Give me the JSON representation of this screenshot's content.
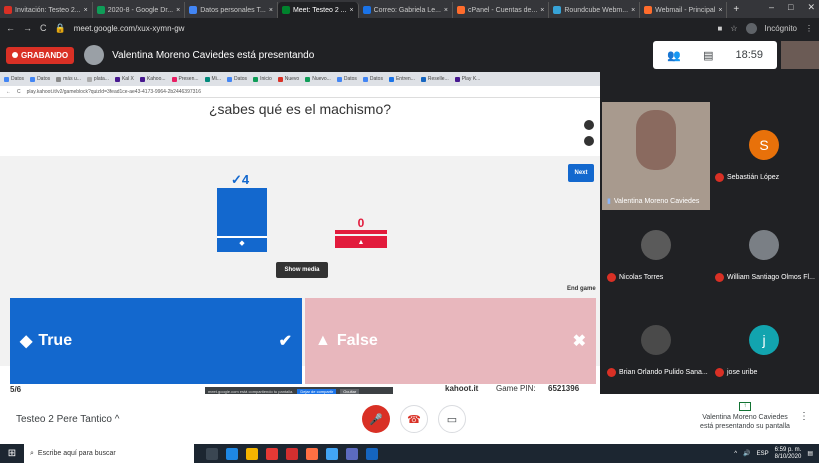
{
  "browser": {
    "tabs": [
      {
        "label": "Invitación: Testeo 2...",
        "color": "#d93025",
        "active": false
      },
      {
        "label": "2020-8 - Google Dr...",
        "color": "#0f9d58",
        "active": false
      },
      {
        "label": "Datos personales T...",
        "color": "#4285f4",
        "active": false
      },
      {
        "label": "Meet: Testeo 2 ...",
        "color": "#00832d",
        "active": true
      },
      {
        "label": "Correo: Gabriela Le...",
        "color": "#1a73e8",
        "active": false
      },
      {
        "label": "cPanel - Cuentas de...",
        "color": "#ff6c2c",
        "active": false
      },
      {
        "label": "Roundcube Webm...",
        "color": "#37a3d7",
        "active": false
      },
      {
        "label": "Webmail - Principal",
        "color": "#ff6c2c",
        "active": false
      }
    ],
    "new_tab": "+",
    "window_controls": [
      "–",
      "□",
      "✕"
    ],
    "url": "meet.google.com/xux-xymn-gw",
    "incognito_label": "Incógnito"
  },
  "meet": {
    "recording_label": "GRABANDO",
    "presenting_text": "Valentina Moreno Caviedes está presentando",
    "time": "18:59",
    "meeting_name": "Testeo 2 Pere Tantico",
    "presenting_name": "Valentina Moreno Caviedes",
    "presenting_subtitle": "está presentando su pantalla",
    "participants": [
      {
        "name": "Valentina Moreno Caviedes",
        "initial": "",
        "color": "#8a6a5f",
        "muted": false,
        "speaking": true
      },
      {
        "name": "Sebastián López",
        "initial": "S",
        "color": "#e8710a",
        "muted": true,
        "speaking": false
      },
      {
        "name": "Nicolas Torres",
        "initial": "",
        "color": "#5a5a5a",
        "muted": true,
        "speaking": false
      },
      {
        "name": "William Santiago Olmos Fl...",
        "initial": "",
        "color": "#7a7f85",
        "muted": true,
        "speaking": false
      },
      {
        "name": "Brian Orlando Pulido Sana...",
        "initial": "",
        "color": "#4a4a4a",
        "muted": true,
        "speaking": false
      },
      {
        "name": "jose uribe",
        "initial": "j",
        "color": "#12a4af",
        "muted": true,
        "speaking": false
      }
    ]
  },
  "inner_browser": {
    "tabs": [
      "Datos",
      "Datos",
      "más u...",
      "plata...",
      "Kal X",
      "Kahoo...",
      "Presen...",
      "Mi...",
      "Datos",
      "Inicio",
      "Nuevo",
      "Nuevo...",
      "Datos",
      "Datos",
      "Entren...",
      "Reselle...",
      "Play K..."
    ],
    "url": "play.kahoot.it/v2/gameblock?quizId=3fead1ce-ae43-4173-9964-2b2446397316"
  },
  "kahoot": {
    "question": "¿sabes qué es el machismo?",
    "next_label": "Next",
    "correct_count": "4",
    "wrong_count": "0",
    "show_media_label": "Show media",
    "end_game_label": "End game",
    "answers": [
      {
        "label": "True",
        "color": "#1368ce",
        "correct": true
      },
      {
        "label": "False",
        "color": "#e21b3c",
        "correct": false
      }
    ],
    "progress": "5/6",
    "brand": "kahoot.it",
    "pin_label": "Game PIN:",
    "pin": "6521396",
    "share_text": "meet.google.com está compartiendo tu pantalla.",
    "stop_share_label": "Dejar de compartir",
    "hide_label": "Ocultar"
  },
  "taskbar": {
    "search_placeholder": "Escribe aquí para buscar",
    "lang": "ESP",
    "time": "6:59 p. m.",
    "date": "8/10/2020"
  },
  "colors": {
    "kahoot_blue": "#1368ce",
    "kahoot_red": "#e21b3c",
    "recording_red": "#d93025"
  }
}
